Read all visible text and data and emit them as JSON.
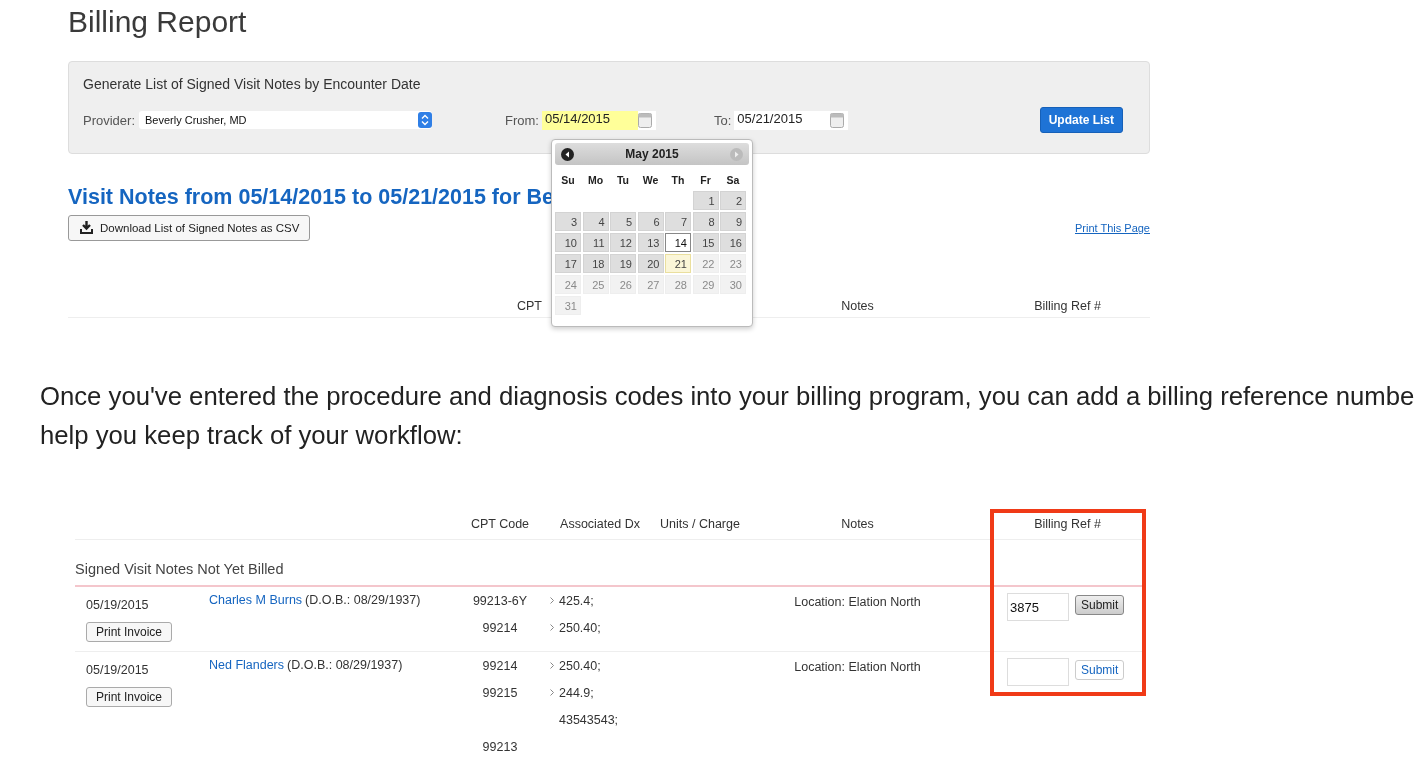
{
  "page_title": "Billing Report",
  "filter_panel": {
    "title": "Generate List of Signed Visit Notes by Encounter Date",
    "provider_label": "Provider:",
    "provider": "Beverly Crusher, MD",
    "from_label": "From:",
    "from": {
      "value": "05/14/2015",
      "focused": true
    },
    "to_label": "To:",
    "to": {
      "value": "05/21/2015",
      "focused": false
    },
    "button": "Update List"
  },
  "date_picker": {
    "month": "May 2015",
    "weekdays": [
      "Su",
      "Mo",
      "Tu",
      "We",
      "Th",
      "Fr",
      "Sa"
    ],
    "weeks": [
      [
        {
          "day": "1",
          "selected": false,
          "today": false,
          "disabled": false
        },
        {
          "day": "2",
          "selected": false,
          "today": false,
          "disabled": false
        }
      ],
      [
        {
          "day": "3",
          "selected": false,
          "today": false,
          "disabled": false
        },
        {
          "day": "4",
          "selected": false,
          "today": false,
          "disabled": false
        },
        {
          "day": "5",
          "selected": false,
          "today": false,
          "disabled": false
        },
        {
          "day": "6",
          "selected": false,
          "today": false,
          "disabled": false
        },
        {
          "day": "7",
          "selected": false,
          "today": false,
          "disabled": false
        },
        {
          "day": "8",
          "selected": false,
          "today": false,
          "disabled": false
        },
        {
          "day": "9",
          "selected": false,
          "today": false,
          "disabled": false
        }
      ],
      [
        {
          "day": "10",
          "selected": false,
          "today": false,
          "disabled": false
        },
        {
          "day": "11",
          "selected": false,
          "today": false,
          "disabled": false
        },
        {
          "day": "12",
          "selected": false,
          "today": false,
          "disabled": false
        },
        {
          "day": "13",
          "selected": false,
          "today": false,
          "disabled": false
        },
        {
          "day": "14",
          "selected": true,
          "today": false,
          "disabled": false
        },
        {
          "day": "15",
          "selected": false,
          "today": false,
          "disabled": false
        },
        {
          "day": "16",
          "selected": false,
          "today": false,
          "disabled": false
        }
      ],
      [
        {
          "day": "17",
          "selected": false,
          "today": false,
          "disabled": false
        },
        {
          "day": "18",
          "selected": false,
          "today": false,
          "disabled": false
        },
        {
          "day": "19",
          "selected": false,
          "today": false,
          "disabled": false
        },
        {
          "day": "20",
          "selected": false,
          "today": false,
          "disabled": false
        },
        {
          "day": "21",
          "selected": false,
          "today": true,
          "disabled": false
        },
        {
          "day": "22",
          "selected": false,
          "today": false,
          "disabled": true
        },
        {
          "day": "23",
          "selected": false,
          "today": false,
          "disabled": true
        }
      ],
      [
        {
          "day": "24",
          "selected": false,
          "today": false,
          "disabled": true
        },
        {
          "day": "25",
          "selected": false,
          "today": false,
          "disabled": true
        },
        {
          "day": "26",
          "selected": false,
          "today": false,
          "disabled": true
        },
        {
          "day": "27",
          "selected": false,
          "today": false,
          "disabled": true
        },
        {
          "day": "28",
          "selected": false,
          "today": false,
          "disabled": true
        },
        {
          "day": "29",
          "selected": false,
          "today": false,
          "disabled": true
        },
        {
          "day": "30",
          "selected": false,
          "today": false,
          "disabled": true
        }
      ],
      [
        {
          "day": "31",
          "selected": false,
          "today": false,
          "disabled": true
        }
      ]
    ]
  },
  "results_heading": "Visit Notes from 05/14/2015 to 05/21/2015 for Be",
  "download_button": "Download List of Signed Notes as CSV",
  "print_link": "Print This Page",
  "table_1": {
    "columns": [
      "CPT",
      "Notes",
      "Billing Ref #"
    ]
  },
  "paragraph_lines": [
    "Once you've entered the procedure and diagnosis codes into your billing program, you can add a billing reference numbe",
    "help you keep track of your workflow:"
  ],
  "table_2": {
    "columns": [
      "CPT Code",
      "Associated Dx",
      "Units / Charge",
      "Notes",
      "Billing Ref #"
    ],
    "section": "Signed Visit Notes Not Yet Billed",
    "rows": [
      {
        "date": "05/19/2015",
        "print_button": "Print Invoice",
        "patient": "Charles M Burns",
        "dob": "(D.O.B.: 08/29/1937)",
        "lines": [
          {
            "cpt": "99213-6Y",
            "dx": "425.4;",
            "chevron": true
          },
          {
            "cpt": "99214",
            "dx": "250.40;",
            "chevron": true
          }
        ],
        "notes": "Location: Elation North",
        "billing_ref": "3875",
        "submit": "Submit",
        "submit_active": true
      },
      {
        "date": "05/19/2015",
        "print_button": "Print Invoice",
        "patient": "Ned Flanders",
        "dob": "(D.O.B.: 08/29/1937)",
        "lines": [
          {
            "cpt": "99214",
            "dx": "250.40;",
            "chevron": true
          },
          {
            "cpt": "99215",
            "dx": "244.9;",
            "chevron": true
          },
          {
            "dx": "43543543;",
            "chevron": false
          },
          {
            "cpt": "99213",
            "chevron": false
          }
        ],
        "notes": "Location: Elation North",
        "submit": "Submit",
        "submit_active": false
      }
    ]
  }
}
